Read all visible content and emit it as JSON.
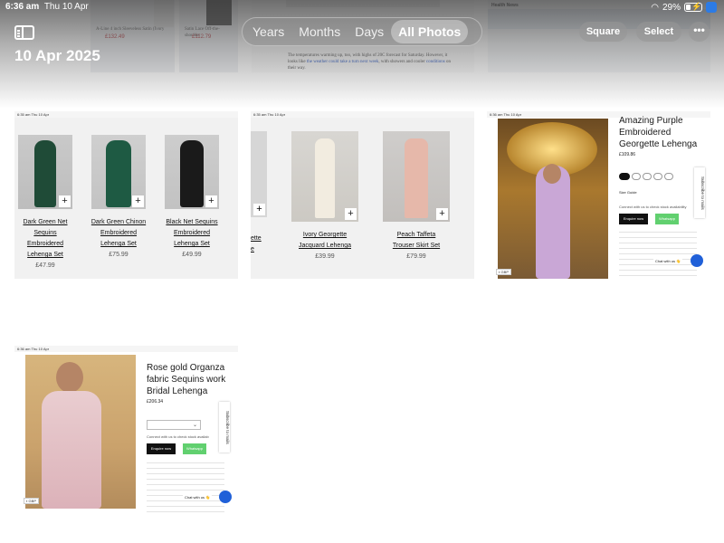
{
  "status_bar": {
    "time": "6:36 am",
    "date": "Thu 10 Apr",
    "battery": "29%",
    "battery_level": 0.29
  },
  "header": {
    "title": "10 Apr 2025",
    "segments": [
      {
        "label": "Years",
        "active": false
      },
      {
        "label": "Months",
        "active": false
      },
      {
        "label": "Days",
        "active": false
      },
      {
        "label": "All Photos",
        "active": true
      }
    ],
    "square_label": "Square",
    "select_label": "Select",
    "more_label": "•••",
    "sidebar_icon": "sidebar-icon"
  },
  "previous_strip": {
    "thumb1_caption": "A-Line 4 inch Sleeveless Satin (Ivory",
    "thumb1_price": "£132.49",
    "thumb2_caption": "Satin Lace Off-the-shoulder",
    "thumb2_price": "£112.79",
    "news_line1": "The temperatures warming up, too, with highs of 20C forecast for Saturday.",
    "news_line2": "However, it looks like",
    "news_link": "the weather could take a turn next week",
    "news_line3": ", with",
    "news_line4": "showers and cooler",
    "news_link2": "conditions",
    "news_line5": "on their way.",
    "health_news": "Health News"
  },
  "tile1": {
    "status": "6:35 am  Thu 10 Apr",
    "products": [
      {
        "name_l1": "Dark Green Net",
        "name_l2": "Sequins",
        "name_l3": "Embroidered",
        "name_l4": "Lehenga Set",
        "price": "£47.99"
      },
      {
        "name_l1": "Dark Green Chinon",
        "name_l2": "Embroidered",
        "name_l3": "Lehenga Set",
        "name_l4": "",
        "price": "£75.99"
      },
      {
        "name_l1": "Black Net Sequins",
        "name_l2": "Embroidered",
        "name_l3": "Lehenga Set",
        "name_l4": "",
        "price": "£49.99"
      }
    ]
  },
  "tile2": {
    "status": "6:35 am  Thu 10 Apr",
    "partial_name_l1": "ette",
    "partial_name_l2": "e",
    "products": [
      {
        "name_l1": "Ivory Georgette",
        "name_l2": "Jacquard Lehenga",
        "price": "£39.99"
      },
      {
        "name_l1": "Peach Taffeta",
        "name_l2": "Trouser Skirt Set",
        "price": "£79.99"
      }
    ]
  },
  "tile3": {
    "status": "6:36 am  Thu 10 Apr",
    "title_l1": "Amazing Purple",
    "title_l2": "Embroidered",
    "title_l3": "Georgette Lehenga",
    "price": "£109.86",
    "size_guide": "Size Guide",
    "connect": "Connect with us to check stock availability",
    "enquire": "Enquire now",
    "whatsapp": "Whatsapp",
    "subscribe": "Subscribe to mails",
    "chat": "Chat with us 👋",
    "currency": "GBP"
  },
  "tile4": {
    "status": "6:36 am  Thu 10 Apr",
    "title_l1": "Rose gold Organza",
    "title_l2": "fabric Sequins work",
    "title_l3": "Bridal Lehenga",
    "price": "£206.34",
    "connect": "Connect with us to check stock availab",
    "enquire": "Enquire now",
    "whatsapp": "Whatsapp",
    "subscribe": "Subscribe to mails",
    "chat": "Chat with us 👋",
    "currency": "GBP"
  },
  "colors": {
    "accent_blue": "#2060d8",
    "whatsapp_green": "#61d06f",
    "price_red": "#b2272d",
    "link_blue": "#2856c4"
  }
}
